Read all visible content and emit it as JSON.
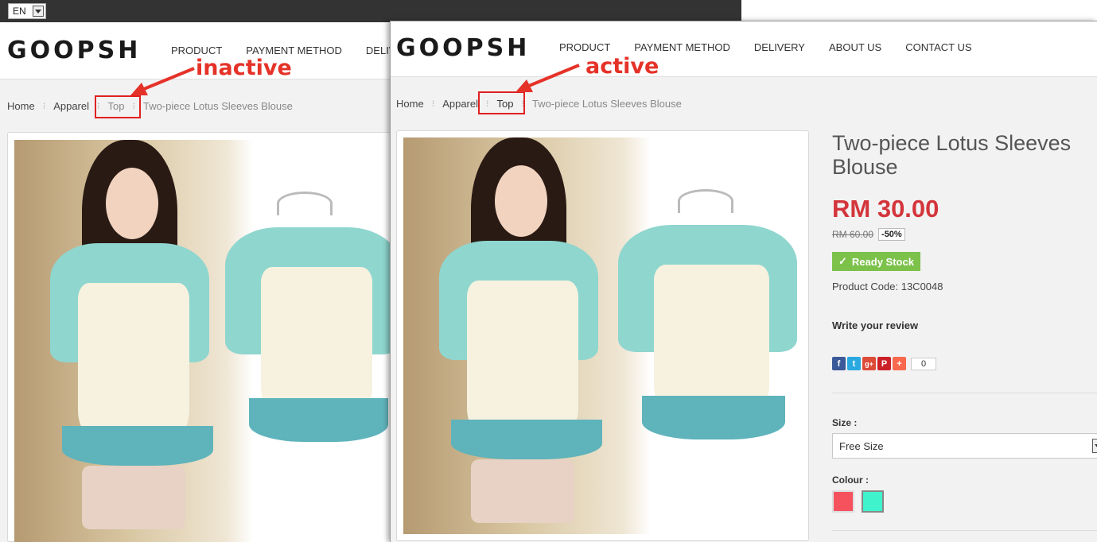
{
  "language": "EN",
  "brand": "GOOPSH",
  "nav_back": [
    "PRODUCT",
    "PAYMENT METHOD",
    "DELIV"
  ],
  "nav_front": [
    "PRODUCT",
    "PAYMENT METHOD",
    "DELIVERY",
    "ABOUT US",
    "CONTACT US"
  ],
  "breadcrumb_back": [
    "Home",
    "Apparel",
    "Top",
    "Two-piece Lotus Sleeves Blouse"
  ],
  "breadcrumb_front": [
    "Home",
    "Apparel",
    "Top",
    "Two-piece Lotus Sleeves Blouse"
  ],
  "annotations": {
    "inactive": "inactive",
    "active": "active"
  },
  "product": {
    "title": "Two-piece Lotus Sleeves Blouse",
    "price": "RM 30.00",
    "old_price": "RM 60.00",
    "discount": "-50%",
    "stock": "Ready Stock",
    "stock_icon": "check-icon",
    "code_label": "Product Code: 13C0048",
    "review_link": "Write your review",
    "share_count": "0",
    "size_label": "Size :",
    "size_value": "Free Size",
    "colour_label": "Colour :",
    "colours": [
      "#f5525e",
      "#3ff3cc"
    ]
  },
  "colors": {
    "accent_red": "#e53228",
    "price_red": "#d3353b",
    "stock_green": "#7cc14a",
    "topbar": "#333333"
  }
}
